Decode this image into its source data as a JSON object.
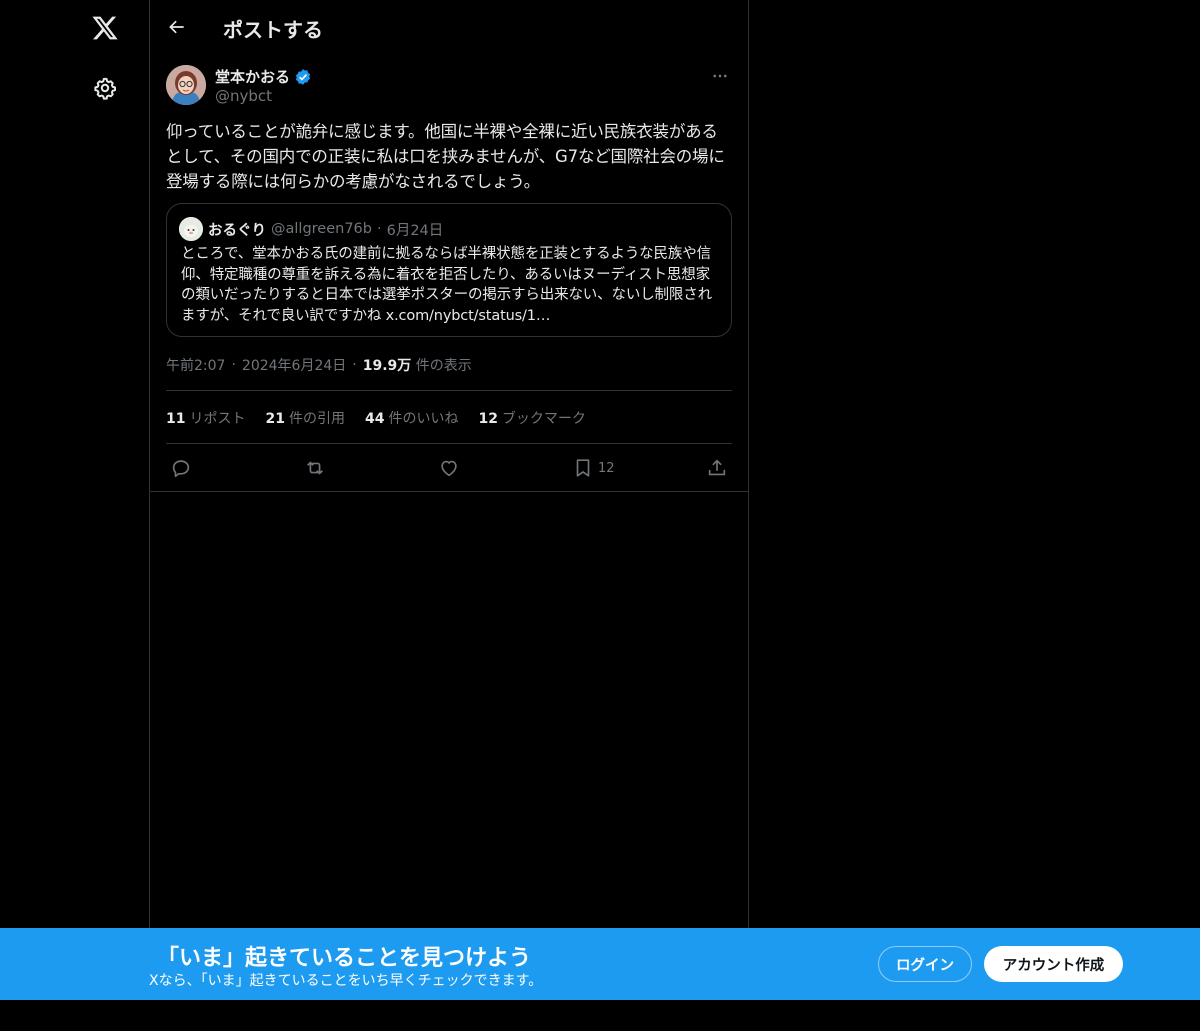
{
  "nav": {
    "logo_icon": "x-logo-icon",
    "settings_icon": "gear-icon"
  },
  "header": {
    "title": "ポストする",
    "back_icon": "arrow-left-icon"
  },
  "post": {
    "author_name": "堂本かおる",
    "author_handle": "@nybct",
    "verified": true,
    "text": "仰っていることが詭弁に感じます。他国に半裸や全裸に近い民族衣装があるとして、その国内での正装に私は口を挟みませんが、G7など国際社会の場に登場する際には何らかの考慮がなされるでしょう。",
    "quote": {
      "author_name": "おるぐり",
      "author_handle": "@allgreen76b",
      "separator": "·",
      "date": "6月24日",
      "text": "ところで、堂本かおる氏の建前に拠るならば半裸状態を正装とするような民族や信仰、特定職種の尊重を訴える為に着衣を拒否したり、あるいはヌーディスト思想家の類いだったりすると日本では選挙ポスターの掲示すら出来ない、ないし制限されますが、それで良い訳ですかね x.com/nybct/status/1…"
    },
    "meta": {
      "time": "午前2:07",
      "dot1": "·",
      "date": "2024年6月24日",
      "dot2": "·",
      "views_count": "19.9万",
      "views_label": "件の表示"
    },
    "stats": [
      {
        "count": "11",
        "label": "リポスト"
      },
      {
        "count": "21",
        "label": "件の引用"
      },
      {
        "count": "44",
        "label": "件のいいね"
      },
      {
        "count": "12",
        "label": "ブックマーク"
      }
    ],
    "actions": {
      "bookmark_count": "12"
    }
  },
  "banner": {
    "title": "「いま」起きていることを見つけよう",
    "subtitle": "Xなら、「いま」起きていることをいち早くチェックできます。",
    "login_label": "ログイン",
    "signup_label": "アカウント作成"
  },
  "colors": {
    "background": "#000000",
    "text": "#e7e9ea",
    "muted": "#71767b",
    "border": "#2f3336",
    "accent": "#1d9bf0"
  }
}
